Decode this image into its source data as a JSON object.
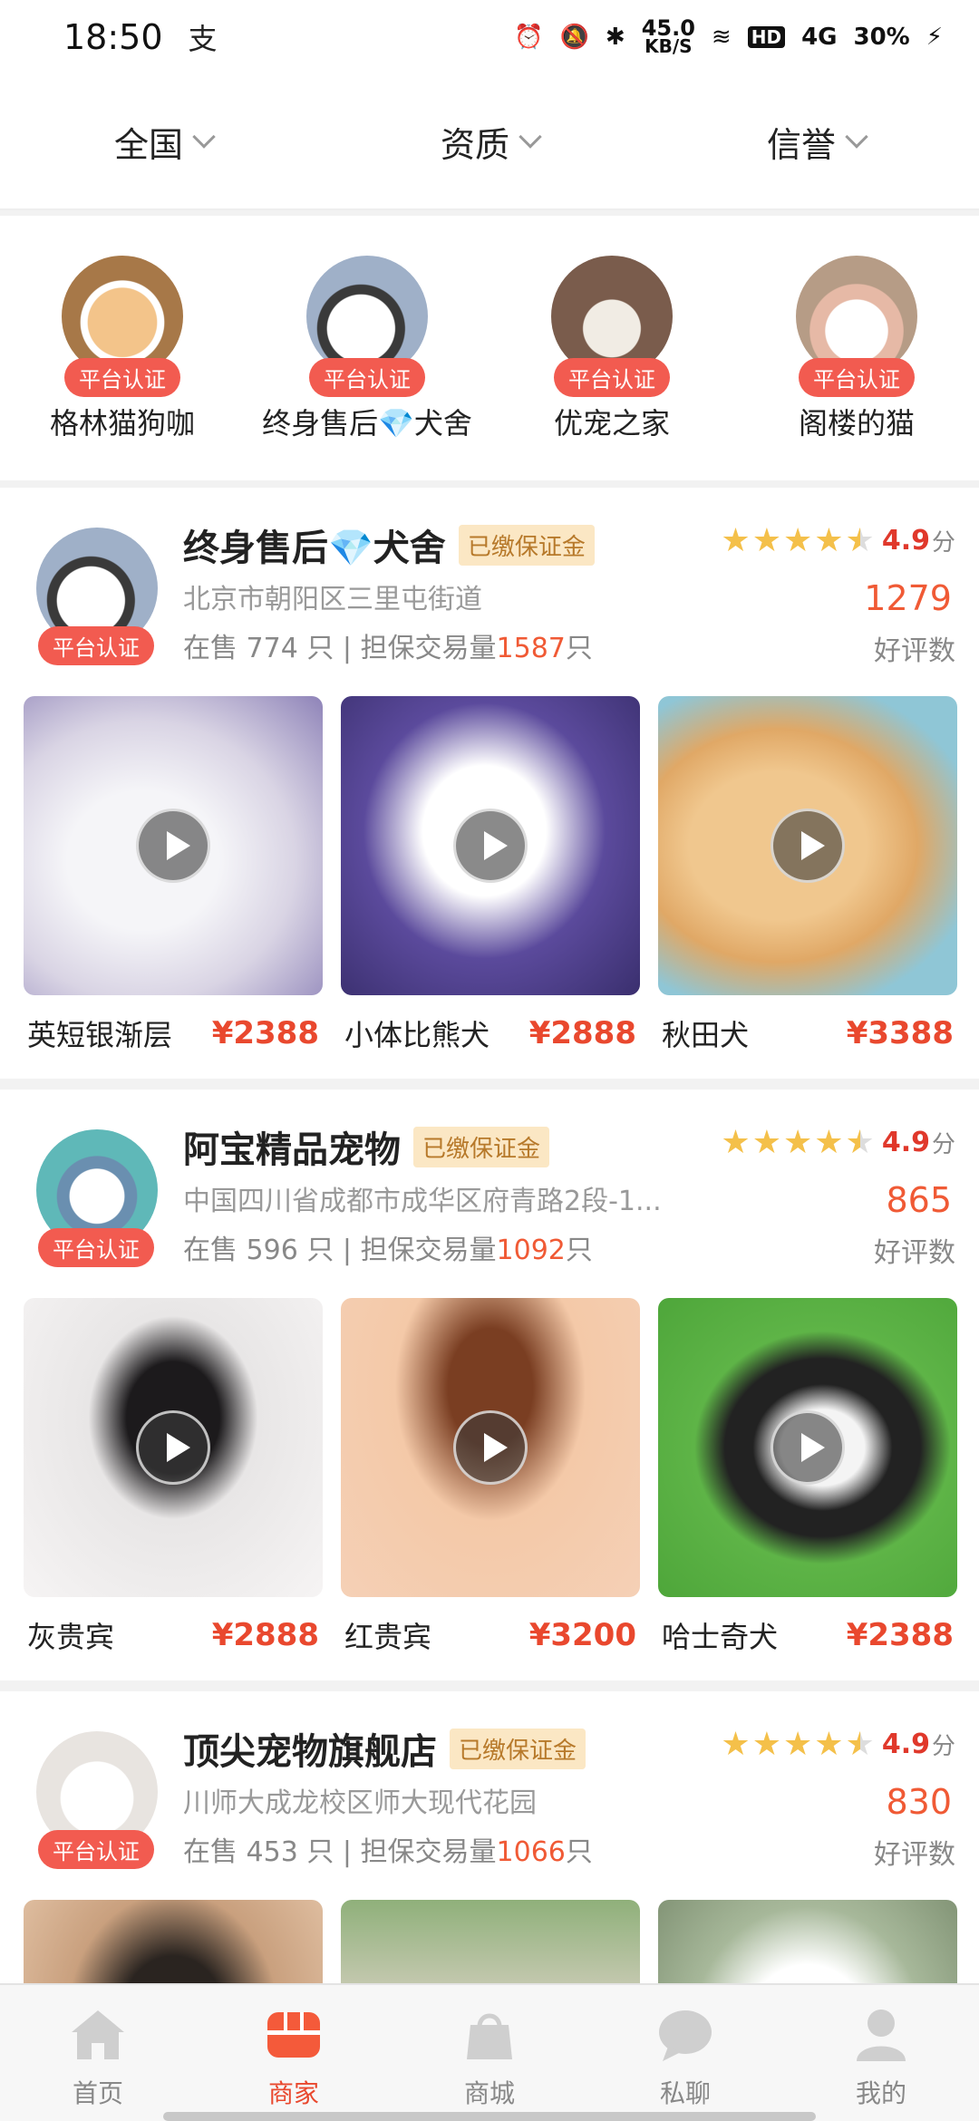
{
  "status": {
    "time": "18:50",
    "notif_glyph": "支",
    "speed_value": "45.0",
    "speed_unit": "KB/S",
    "hd": "HD",
    "signal": "4G",
    "battery": "30%"
  },
  "filters": [
    {
      "label": "全国"
    },
    {
      "label": "资质"
    },
    {
      "label": "信誉"
    }
  ],
  "featured": [
    {
      "name": "格林猫狗咖",
      "badge": "平台认证",
      "color": "#d6a26e"
    },
    {
      "name": "终身售后💎犬舍",
      "badge": "平台认证",
      "color": "#8c9bb6"
    },
    {
      "name": "优宠之家",
      "badge": "平台认证",
      "color": "#6b5347"
    },
    {
      "name": "阁楼的猫",
      "badge": "平台认证",
      "color": "#c9b09a"
    }
  ],
  "shops": [
    {
      "name": "终身售后💎犬舍",
      "tag": "已缴保证金",
      "badge": "平台认证",
      "address": "北京市朝阳区三里屯街道",
      "stats_prefix": "在售 774 只 | 担保交易量",
      "volume": "1587",
      "stats_suffix": "只",
      "score": "4.9",
      "score_unit": "分",
      "good_count": "1279",
      "good_label": "好评数",
      "products": [
        {
          "name": "英短银渐层",
          "price": "¥2388"
        },
        {
          "name": "小体比熊犬",
          "price": "¥2888"
        },
        {
          "name": "秋田犬",
          "price": "¥3388"
        }
      ]
    },
    {
      "name": "阿宝精品宠物",
      "tag": "已缴保证金",
      "badge": "平台认证",
      "address": "中国四川省成都市成华区府青路2段-1...",
      "stats_prefix": "在售 596 只 | 担保交易量",
      "volume": "1092",
      "stats_suffix": "只",
      "score": "4.9",
      "score_unit": "分",
      "good_count": "865",
      "good_label": "好评数",
      "products": [
        {
          "name": "灰贵宾",
          "price": "¥2888"
        },
        {
          "name": "红贵宾",
          "price": "¥3200"
        },
        {
          "name": "哈士奇犬",
          "price": "¥2388"
        }
      ]
    },
    {
      "name": "顶尖宠物旗舰店",
      "tag": "已缴保证金",
      "badge": "平台认证",
      "address": "川师大成龙校区师大现代花园",
      "stats_prefix": "在售 453 只 | 担保交易量",
      "volume": "1066",
      "stats_suffix": "只",
      "score": "4.9",
      "score_unit": "分",
      "good_count": "830",
      "good_label": "好评数",
      "products": []
    }
  ],
  "tabs": [
    {
      "label": "首页",
      "icon": "home-icon"
    },
    {
      "label": "商家",
      "icon": "shop-icon"
    },
    {
      "label": "商城",
      "icon": "bag-icon"
    },
    {
      "label": "私聊",
      "icon": "chat-icon"
    },
    {
      "label": "我的",
      "icon": "user-icon"
    }
  ],
  "colors": {
    "accent": "#e9482e",
    "badge": "#f25b50",
    "star": "#f4c04a",
    "tag_bg": "#fbe7c4",
    "tag_text": "#b7792a"
  }
}
